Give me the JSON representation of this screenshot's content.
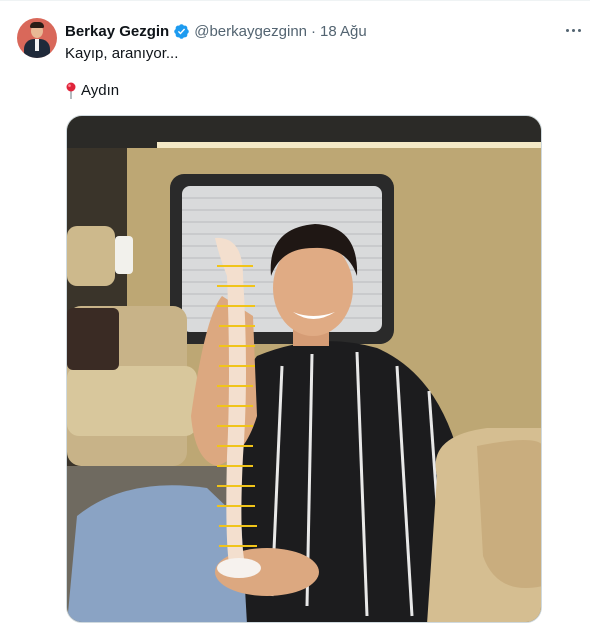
{
  "tweet": {
    "author_name": "Berkay Gezgin",
    "handle": "@berkaygezginn",
    "separator": "·",
    "timestamp": "18 Ağu",
    "text_line_1": "Kayıp, aranıyor...",
    "location": "Aydın",
    "icons": {
      "verified": "verified-badge-icon",
      "more": "more-options-icon",
      "pin": "round-pushpin-icon"
    },
    "colors": {
      "verified_blue": "#1d9bf0",
      "secondary_text": "#536471",
      "pin_red": "#e0243a"
    }
  }
}
